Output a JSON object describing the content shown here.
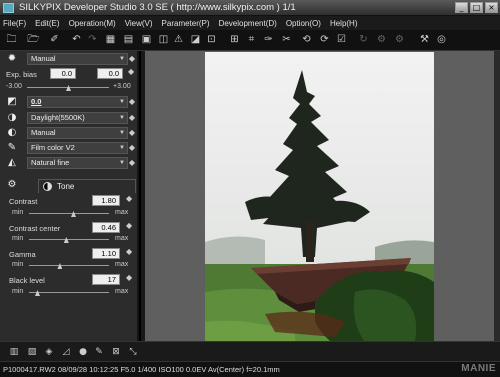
{
  "window": {
    "title": "SILKYPIX Developer Studio 3.0 SE ( http://www.silkypix.com )    1/1",
    "minimize": "_",
    "maximize": "□",
    "close": "×"
  },
  "menu": [
    "File(F)",
    "Edit(E)",
    "Operation(M)",
    "View(V)",
    "Parameter(P)",
    "Development(D)",
    "Option(O)",
    "Help(H)"
  ],
  "panel": {
    "rows": [
      {
        "icon": "sun-icon",
        "glyph": "✹",
        "value": "Manual"
      },
      {
        "icon": "contrast-icon",
        "glyph": "◩",
        "value": "0.0"
      },
      {
        "icon": "white-balance-icon",
        "glyph": "◑",
        "value": "Daylight(5500K)"
      },
      {
        "icon": "saturation-icon",
        "glyph": "◐",
        "value": "Manual"
      },
      {
        "icon": "eyedropper-icon",
        "glyph": "✎",
        "value": "Film color V2"
      },
      {
        "icon": "sharpness-icon",
        "glyph": "◭",
        "value": "Natural fine"
      }
    ],
    "exp_bias": {
      "label": "Exp. bias",
      "value_a": "0.0",
      "value_b": "0.0",
      "min": "-3.00",
      "max": "+3.00",
      "position": 0.5
    },
    "tone_tab": "Tone",
    "tone_sliders": [
      {
        "label": "Contrast",
        "value": "1.80",
        "min": "min",
        "max": "max",
        "position": 0.55
      },
      {
        "label": "Contrast center",
        "value": "0.46",
        "min": "min",
        "max": "max",
        "position": 0.46
      },
      {
        "label": "Gamma",
        "value": "1.10",
        "min": "min",
        "max": "max",
        "position": 0.38
      },
      {
        "label": "Black level",
        "value": "17",
        "min": "min",
        "max": "max",
        "position": 0.1
      }
    ]
  },
  "statusbar": {
    "text": "P1000417.RW2  08/09/28  10:12:25  F5.0  1/400  ISO100   0.0EV  Av(Center)  f=20.1mm",
    "watermark": "MANIE"
  },
  "colors": {
    "window_bg": "#2c2c2c",
    "viewer_bg": "#5f5f5f",
    "toolbar_bg": "#111111"
  }
}
